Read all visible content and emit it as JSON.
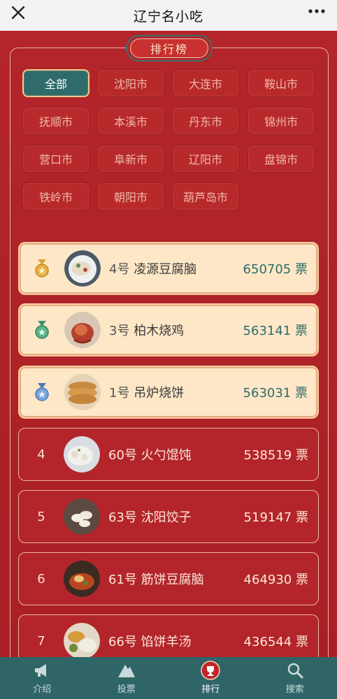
{
  "header": {
    "title": "辽宁名小吃"
  },
  "ranking_label": "排行榜",
  "cities": [
    {
      "label": "全部",
      "active": true
    },
    {
      "label": "沈阳市"
    },
    {
      "label": "大连市"
    },
    {
      "label": "鞍山市"
    },
    {
      "label": "抚顺市"
    },
    {
      "label": "本溪市"
    },
    {
      "label": "丹东市"
    },
    {
      "label": "锦州市"
    },
    {
      "label": "营口市"
    },
    {
      "label": "阜新市"
    },
    {
      "label": "辽阳市"
    },
    {
      "label": "盘锦市"
    },
    {
      "label": "铁岭市"
    },
    {
      "label": "朝阳市"
    },
    {
      "label": "葫芦岛市"
    }
  ],
  "rankings": [
    {
      "rank": "1",
      "medal": "gold-medal-icon",
      "entry": "4号",
      "name": "凌源豆腐脑",
      "votes": "650705",
      "unit": "票",
      "food": "tofu-pudding"
    },
    {
      "rank": "2",
      "medal": "silver-medal-icon",
      "entry": "3号",
      "name": "柏木烧鸡",
      "votes": "563141",
      "unit": "票",
      "food": "roast-chicken"
    },
    {
      "rank": "3",
      "medal": "bronze-medal-icon",
      "entry": "1号",
      "name": "吊炉烧饼",
      "votes": "563031",
      "unit": "票",
      "food": "flatbread"
    },
    {
      "rank": "4",
      "entry": "60号",
      "name": "火勺馄饨",
      "votes": "538519",
      "unit": "票",
      "food": "wonton"
    },
    {
      "rank": "5",
      "entry": "63号",
      "name": "沈阳饺子",
      "votes": "519147",
      "unit": "票",
      "food": "dumplings"
    },
    {
      "rank": "6",
      "entry": "61号",
      "name": "筋饼豆腐脑",
      "votes": "464930",
      "unit": "票",
      "food": "tofu-soup"
    },
    {
      "rank": "7",
      "entry": "66号",
      "name": "馅饼羊汤",
      "votes": "436544",
      "unit": "票",
      "food": "mutton-soup"
    }
  ],
  "nav": [
    {
      "label": "介绍",
      "icon": "megaphone-icon"
    },
    {
      "label": "投票",
      "icon": "mountain-icon"
    },
    {
      "label": "排行",
      "icon": "trophy-icon",
      "active": true
    },
    {
      "label": "搜索",
      "icon": "search-icon"
    }
  ],
  "colors": {
    "accent": "#2f6566",
    "background": "#b02328",
    "gold": "#f1c98a"
  }
}
